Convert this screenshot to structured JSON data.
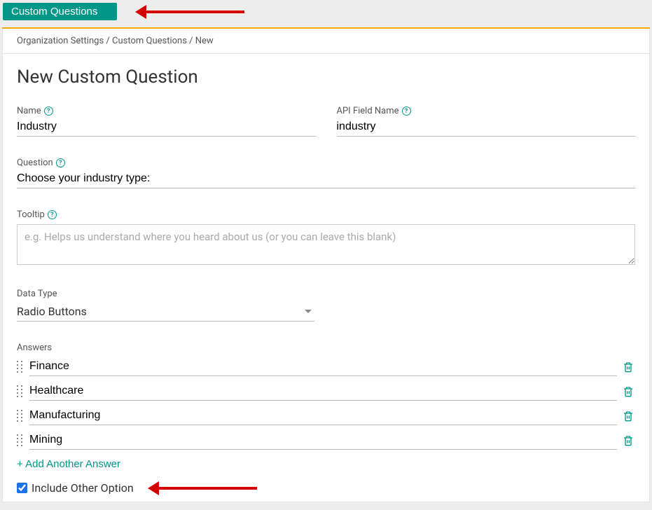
{
  "tab": {
    "label": "Custom Questions"
  },
  "breadcrumb": {
    "org_settings": "Organization Settings",
    "custom_questions": "Custom Questions",
    "current": "New"
  },
  "page": {
    "title": "New Custom Question"
  },
  "fields": {
    "name": {
      "label": "Name",
      "value": "Industry"
    },
    "api": {
      "label": "API Field Name",
      "value": "industry"
    },
    "question": {
      "label": "Question",
      "value": "Choose your industry type:"
    },
    "tooltip": {
      "label": "Tooltip",
      "value": "",
      "placeholder": "e.g. Helps us understand where you heard about us (or you can leave this blank)"
    },
    "datatype": {
      "label": "Data Type",
      "value": "Radio Buttons"
    }
  },
  "answers": {
    "label": "Answers",
    "items": [
      {
        "value": "Finance"
      },
      {
        "value": "Healthcare"
      },
      {
        "value": "Manufacturing"
      },
      {
        "value": "Mining"
      }
    ],
    "add_label": "+ Add Another Answer",
    "include_other_label": "Include Other Option",
    "include_other_checked": true
  }
}
